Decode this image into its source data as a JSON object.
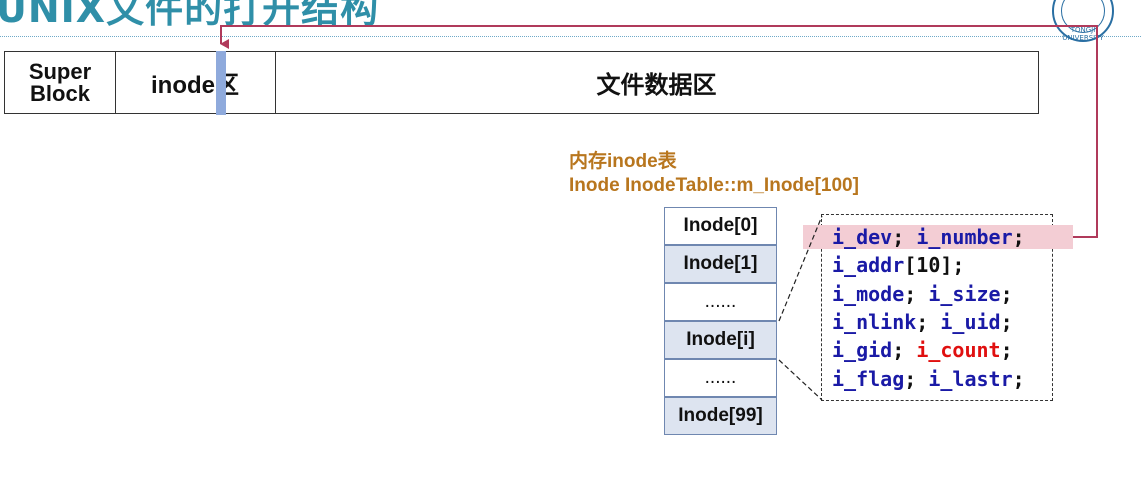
{
  "title": "UNIX文件的打开结构",
  "logo": {
    "text": "TONGJI UNIVERSITY"
  },
  "disk": {
    "super_block": "Super Block",
    "inode_area": "inode区",
    "data_area": "文件数据区"
  },
  "memory": {
    "title_line1": "内存inode表",
    "title_line2": "Inode InodeTable::m_Inode[100]"
  },
  "inode_table": [
    "Inode[0]",
    "Inode[1]",
    "......",
    "Inode[i]",
    "......",
    "Inode[99]"
  ],
  "fields": {
    "l1": [
      "i_dev",
      "; ",
      "i_number",
      ";"
    ],
    "l2": [
      "i_addr",
      "[10];"
    ],
    "l3": [
      "i_mode",
      "; ",
      "i_size",
      ";"
    ],
    "l4": [
      "i_nlink",
      "; ",
      "i_uid",
      ";"
    ],
    "l5": [
      "i_gid",
      "; ",
      "i_count",
      ";"
    ],
    "l6": [
      "i_flag",
      "; ",
      "i_lastr",
      ";"
    ]
  },
  "colors": {
    "title": "#2f8fa8",
    "memory_title": "#b8761e",
    "field_name": "#1a1aa6",
    "highlight_field": "#e01010",
    "arrow": "#b03a5b",
    "highlight_bg": "#f3cdd4"
  }
}
